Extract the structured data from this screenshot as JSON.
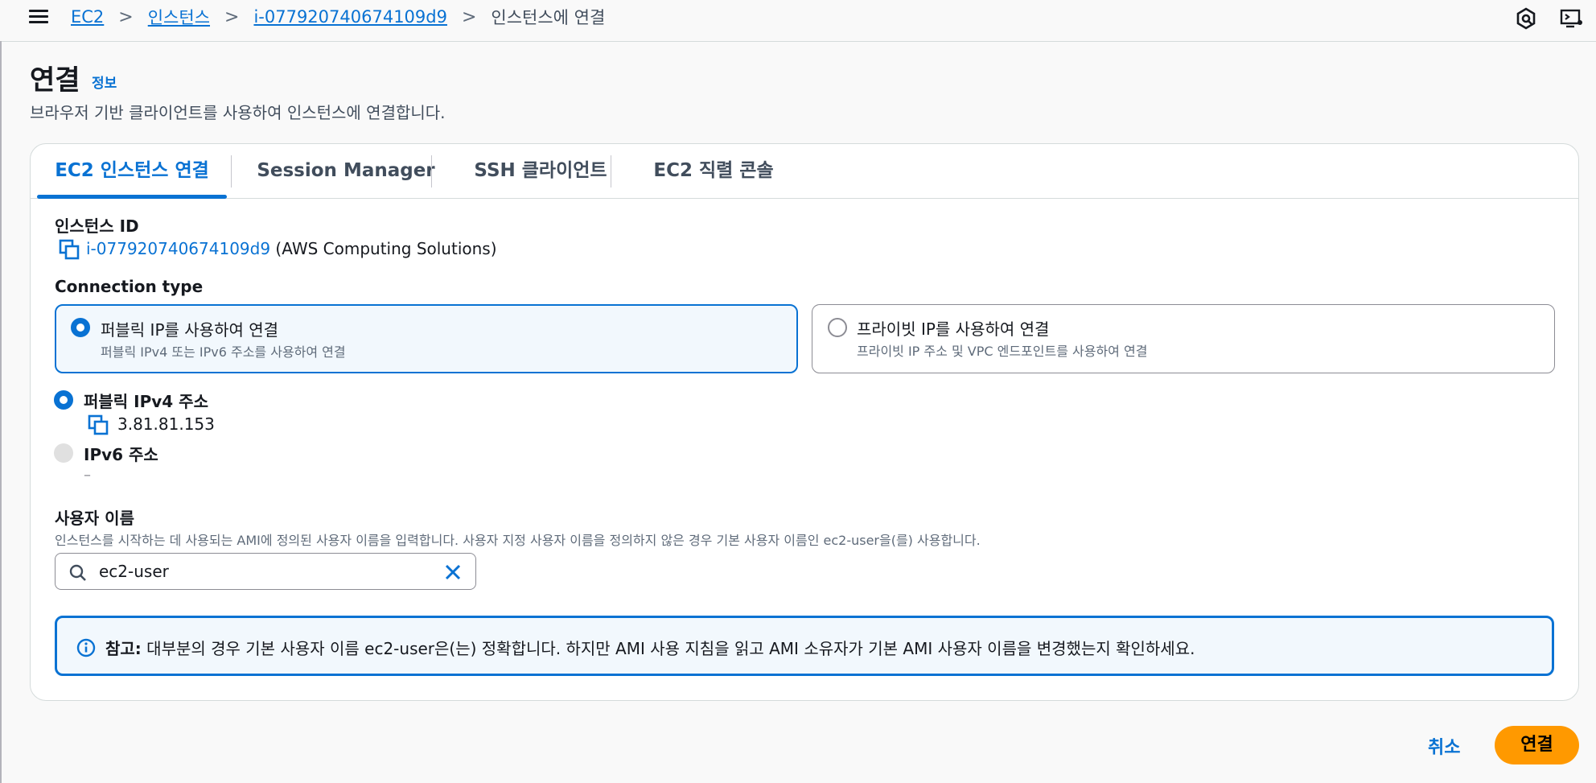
{
  "breadcrumb": {
    "items": [
      "EC2",
      "인스턴스",
      "i-077920740674109d9"
    ],
    "current": "인스턴스에 연결",
    "separator": ">"
  },
  "header": {
    "title": "연결",
    "info": "정보",
    "subtitle": "브라우저 기반 클라이언트를 사용하여 인스턴스에 연결합니다."
  },
  "tabs": [
    {
      "label": "EC2 인스턴스 연결",
      "active": true
    },
    {
      "label": "Session Manager",
      "active": false
    },
    {
      "label": "SSH 클라이언트",
      "active": false
    },
    {
      "label": "EC2 직렬 콘솔",
      "active": false
    }
  ],
  "instance": {
    "label": "인스턴스 ID",
    "id": "i-077920740674109d9",
    "owner": "(AWS Computing Solutions)"
  },
  "connection_type": {
    "label": "Connection type",
    "options": [
      {
        "title": "퍼블릭 IP를 사용하여 연결",
        "desc": "퍼블릭 IPv4 또는 IPv6 주소를 사용하여 연결",
        "selected": true
      },
      {
        "title": "프라이빗 IP를 사용하여 연결",
        "desc": "프라이빗 IP 주소 및 VPC 엔드포인트를 사용하여 연결",
        "selected": false
      }
    ]
  },
  "address": {
    "ipv4_label": "퍼블릭 IPv4 주소",
    "ipv4_value": "3.81.81.153",
    "ipv6_label": "IPv6 주소",
    "ipv6_value": "–"
  },
  "username": {
    "label": "사용자 이름",
    "desc": "인스턴스를 시작하는 데 사용되는 AMI에 정의된 사용자 이름을 입력합니다. 사용자 지정 사용자 이름을 정의하지 않은 경우 기본 사용자 이름인 ec2-user을(를) 사용합니다.",
    "value": "ec2-user"
  },
  "alert": {
    "bold": "참고:",
    "text": "대부분의 경우 기본 사용자 이름 ec2-user은(는) 정확합니다. 하지만 AMI 사용 지침을 읽고 AMI 소유자가 기본 AMI 사용자 이름을 변경했는지 확인하세요."
  },
  "footer": {
    "cancel": "취소",
    "connect": "연결"
  },
  "colors": {
    "accent": "#0972d3",
    "primary_button": "#ff9900"
  }
}
